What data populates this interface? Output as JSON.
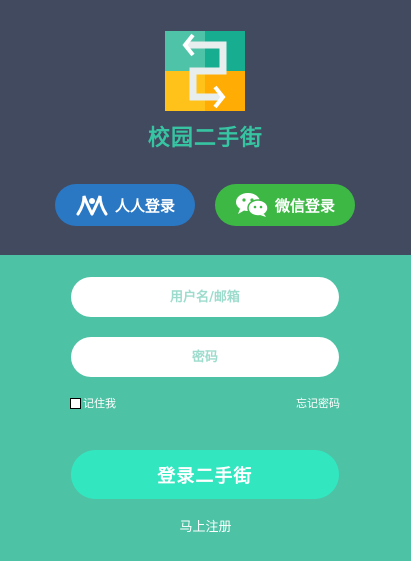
{
  "app": {
    "title": "校园二手街",
    "logo_icon": "campus-secondhand-logo-icon"
  },
  "social": {
    "renren_label": "人人登录",
    "renren_icon": "renren-icon",
    "wechat_label": "微信登录",
    "wechat_icon": "wechat-icon"
  },
  "form": {
    "username_placeholder": "用户名/邮箱",
    "password_placeholder": "密码",
    "remember_label": "记住我",
    "forgot_label": "忘记密码",
    "login_label": "登录二手街",
    "register_label": "马上注册"
  },
  "colors": {
    "header_bg": "#414a5f",
    "body_bg": "#4dc2a4",
    "title": "#37c4a2",
    "renren": "#2a77c4",
    "wechat": "#3db845",
    "login_button": "#32e6c0"
  }
}
